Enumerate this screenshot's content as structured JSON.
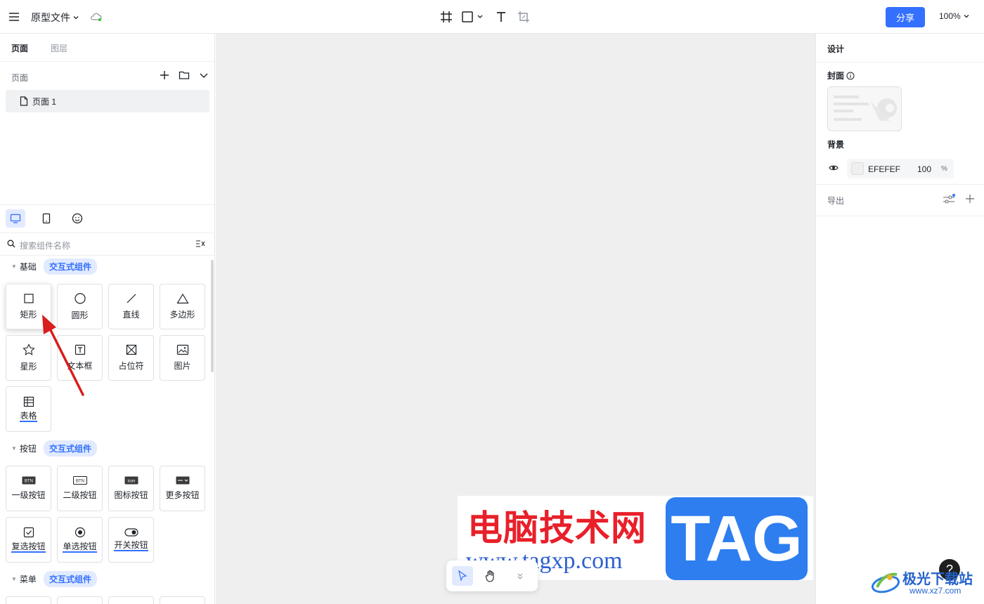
{
  "topbar": {
    "file_name": "原型文件",
    "share_label": "分享",
    "zoom": "100%"
  },
  "left": {
    "tabs": [
      "页面",
      "图层"
    ],
    "pages_title": "页面",
    "page_item": "页面 1",
    "search_placeholder": "搜索组件名称",
    "sections": [
      {
        "name": "基础",
        "badge": "交互式组件",
        "items": [
          "矩形",
          "圆形",
          "直线",
          "多边形",
          "星形",
          "文本框",
          "占位符",
          "图片",
          "表格"
        ]
      },
      {
        "name": "按钮",
        "badge": "交互式组件",
        "items": [
          "一级按钮",
          "二级按钮",
          "图标按钮",
          "更多按钮",
          "复选按钮",
          "单选按钮",
          "开关按钮"
        ]
      },
      {
        "name": "菜单",
        "badge": "交互式组件",
        "items": []
      }
    ],
    "icon_texts": {
      "btn": "BTN",
      "icon": "icon"
    }
  },
  "right": {
    "title": "设计",
    "cover_label": "封面",
    "background_label": "背景",
    "bg_hex": "EFEFEF",
    "bg_opacity": "100",
    "bg_pct": "%",
    "export_label": "导出"
  },
  "watermark": {
    "cn": "电脑技术网",
    "url": "www.tagxp.com",
    "tag": "TAG",
    "jg_text": "极光下载站",
    "jg_url": "www.xz7.com"
  },
  "help": "?",
  "colors": {
    "accent": "#3370ff",
    "canvas": "#efefef",
    "badge_bg": "#e1eaff"
  }
}
